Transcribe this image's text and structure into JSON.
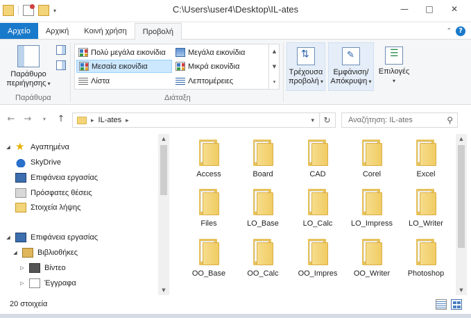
{
  "window": {
    "title": "C:\\Users\\user4\\Desktop\\IL-ates",
    "controls": [
      "—",
      "□",
      "✕"
    ]
  },
  "ribbon_tabs": [
    {
      "label": "Αρχείο",
      "kind": "file"
    },
    {
      "label": "Αρχική",
      "kind": "normal"
    },
    {
      "label": "Κοινή χρήση",
      "kind": "normal"
    },
    {
      "label": "Προβολή",
      "kind": "active"
    }
  ],
  "ribbon": {
    "panes": {
      "nav_pane_label_line1": "Παράθυρο",
      "nav_pane_label_line2": "περιήγησης",
      "group_label": "Παράθυρα"
    },
    "layout": {
      "items": [
        {
          "label": "Πολύ μεγάλα εικονίδια",
          "icon": "extra-large-icons-icon",
          "selected": false
        },
        {
          "label": "Μεγάλα εικονίδια",
          "icon": "large-icons-icon",
          "selected": false
        },
        {
          "label": "Μεσαία εικονίδια",
          "icon": "medium-icons-icon",
          "selected": true
        },
        {
          "label": "Μικρά εικονίδια",
          "icon": "small-icons-icon",
          "selected": false
        },
        {
          "label": "Λίστα",
          "icon": "list-icon",
          "selected": false
        },
        {
          "label": "Λεπτομέρειες",
          "icon": "details-icon",
          "selected": false
        }
      ],
      "group_label": "Διάταξη"
    },
    "current_view": {
      "line1": "Τρέχουσα",
      "line2": "προβολή"
    },
    "show_hide": {
      "line1": "Εμφάνιση/",
      "line2": "Απόκρυψη"
    },
    "options": {
      "label": "Επιλογές"
    }
  },
  "address": {
    "path_segment": "IL-ates",
    "search_placeholder": "Αναζήτηση: IL-ates"
  },
  "nav_pane": {
    "items": [
      {
        "label": "Αγαπημένα",
        "icon": "star-icon"
      },
      {
        "label": "SkyDrive",
        "icon": "cloud-icon"
      },
      {
        "label": "Επιφάνεια εργασίας",
        "icon": "desktop-icon"
      },
      {
        "label": "Πρόσφατες θέσεις",
        "icon": "recent-places-icon"
      },
      {
        "label": "Στοιχεία λήψης",
        "icon": "downloads-icon"
      },
      {
        "label": "Επιφάνεια εργασίας",
        "icon": "desktop-icon"
      },
      {
        "label": "Βιβλιοθήκες",
        "icon": "libraries-icon"
      },
      {
        "label": "Βίντεο",
        "icon": "videos-icon"
      },
      {
        "label": "Έγγραφα",
        "icon": "documents-icon"
      }
    ]
  },
  "folders": [
    "Access",
    "Board",
    "CAD",
    "Corel",
    "Excel",
    "Files",
    "LO_Base",
    "LO_Calc",
    "LO_Impress",
    "LO_Writer",
    "OO_Base",
    "OO_Calc",
    "OO_Impres",
    "OO_Writer",
    "Photoshop"
  ],
  "status": {
    "item_count": "20 στοιχεία"
  },
  "colors": {
    "accent": "#1979ca",
    "folder": "#f0cc63",
    "selection": "#cce8ff"
  }
}
